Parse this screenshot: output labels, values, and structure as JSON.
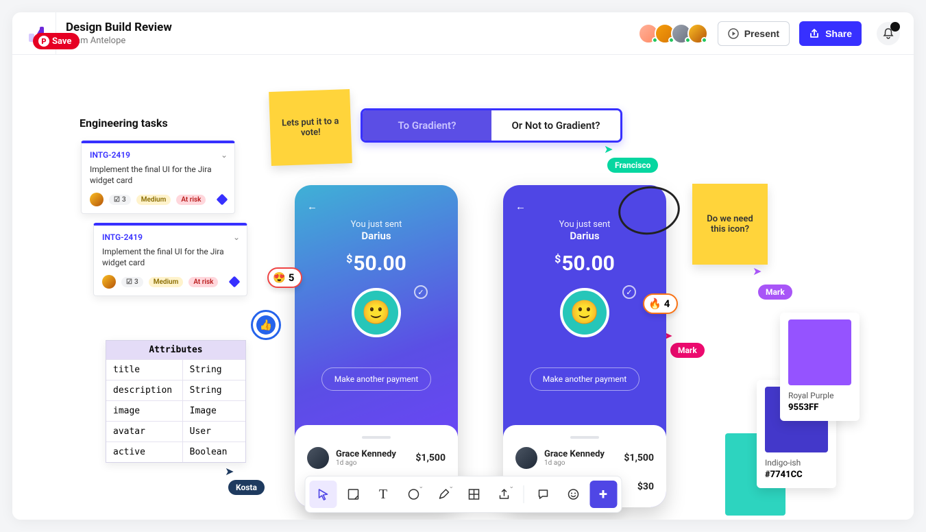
{
  "save_label": "Save",
  "header": {
    "title": "Design Build Review",
    "subtitle": "Team Antelope",
    "present": "Present",
    "share": "Share"
  },
  "eng_title": "Engineering tasks",
  "jira": {
    "id": "INTG-2419",
    "desc": "Implement the final UI for the Jira widget card",
    "count": "3",
    "medium": "Medium",
    "risk": "At risk"
  },
  "attributes": {
    "header": "Attributes",
    "rows": [
      {
        "k": "title",
        "v": "String"
      },
      {
        "k": "description",
        "v": "String"
      },
      {
        "k": "image",
        "v": "Image"
      },
      {
        "k": "avatar",
        "v": "User"
      },
      {
        "k": "active",
        "v": "Boolean"
      }
    ]
  },
  "sticky1": "Lets put it to a vote!",
  "sticky2": "Do we need this icon?",
  "vote_a": "To Gradient?",
  "vote_b": "Or Not to Gradient?",
  "cursors": {
    "francisco": "Francisco",
    "mark": "Mark",
    "kosta": "Kosta"
  },
  "phone": {
    "sent": "You just sent",
    "name": "Darius",
    "amount": "50.00",
    "make": "Make another payment",
    "t1_name": "Grace Kennedy",
    "t1_time": "1d ago",
    "t1_amt": "$1,500",
    "t2_amt": "$30"
  },
  "reactions": {
    "r1": "5",
    "r2": "4"
  },
  "swatches": {
    "purple_name": "Royal Purple",
    "purple_hex": "9553FF",
    "indigo_name": "Indigo-ish",
    "indigo_hex": "#7741CC"
  }
}
